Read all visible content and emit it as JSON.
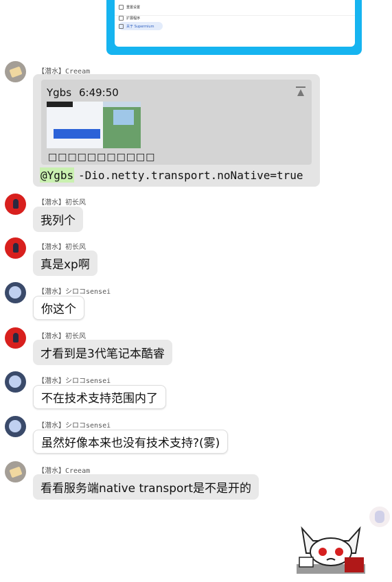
{
  "messages": [
    {
      "sender": "【潜水】Creeam",
      "reply": {
        "name": "Ygbs",
        "time": "6:49:50",
        "caption": "□□□□□□□□□□□"
      },
      "mention": "@Ygbs",
      "text": "-Dio.netty.transport.noNative=true"
    },
    {
      "sender": "【潜水】初长风",
      "text": "我列个"
    },
    {
      "sender": "【潜水】初长风",
      "text": "真是xp啊"
    },
    {
      "sender": "【潜水】シロコsensei",
      "text": "你这个"
    },
    {
      "sender": "【潜水】初长风",
      "text": "才看到是3代笔记本酷睿"
    },
    {
      "sender": "【潜水】シロコsensei",
      "text": "不在技术支持范围内了"
    },
    {
      "sender": "【潜水】シロコsensei",
      "text": "虽然好像本来也没有技术支持?(雾)"
    },
    {
      "sender": "【潜水】Creeam",
      "text": "看看服务端native transport是不是开的"
    }
  ],
  "top_image": {
    "menu": [
      "重置设置",
      "扩展程序",
      "关于 Supermium"
    ]
  },
  "colors": {
    "accent": "#16b4f0",
    "bubble": "#e9e9e9",
    "mention_bg": "#c9f0b0"
  }
}
